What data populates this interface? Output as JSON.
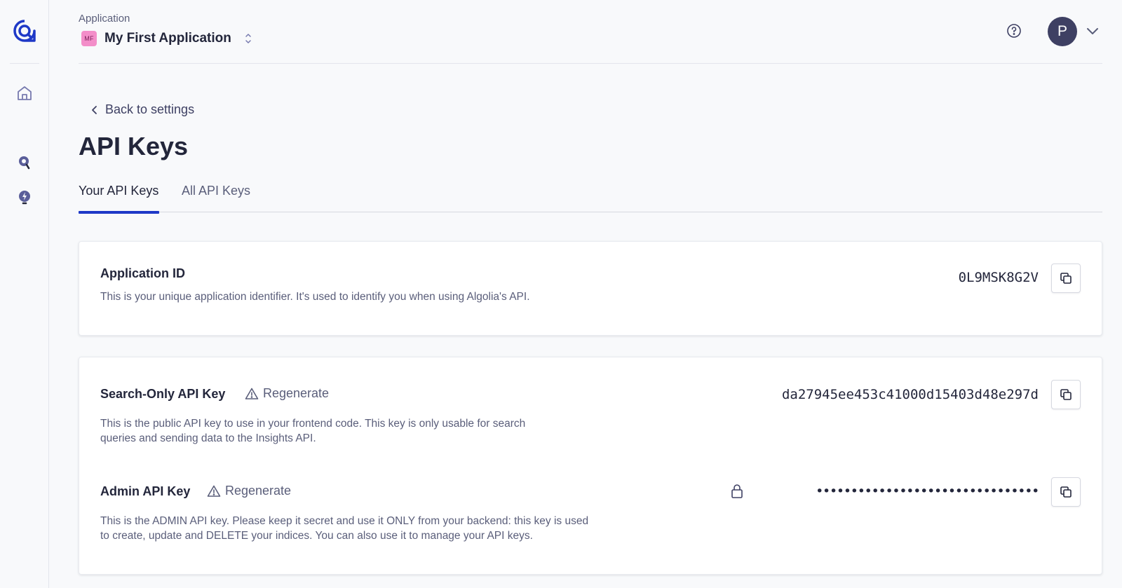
{
  "header": {
    "app_label": "Application",
    "app_badge": "MF",
    "app_name": "My First Application",
    "avatar_initial": "P"
  },
  "nav": {
    "back_label": "Back to settings"
  },
  "page": {
    "title": "API Keys"
  },
  "tabs": [
    {
      "label": "Your API Keys",
      "active": true
    },
    {
      "label": "All API Keys",
      "active": false
    }
  ],
  "application_id": {
    "title": "Application ID",
    "description": "This is your unique application identifier. It's used to identify you when using Algolia's API.",
    "value": "0L9MSK8G2V"
  },
  "search_key": {
    "title": "Search-Only API Key",
    "regenerate_label": "Regenerate",
    "description": "This is the public API key to use in your frontend code. This key is only usable for search queries and sending data to the Insights API.",
    "value": "da27945ee453c41000d15403d48e297d"
  },
  "admin_key": {
    "title": "Admin API Key",
    "regenerate_label": "Regenerate",
    "description": "This is the ADMIN API key. Please keep it secret and use it ONLY from your backend: this key is used to create, update and DELETE your indices. You can also use it to manage your API keys.",
    "value": "••••••••••••••••••••••••••••••••"
  },
  "colors": {
    "accent": "#1f39c7",
    "avatar_bg": "#3e4063",
    "badge_bg": "#f38ec9",
    "text_primary": "#23263b",
    "text_secondary": "#5a5e7a"
  }
}
